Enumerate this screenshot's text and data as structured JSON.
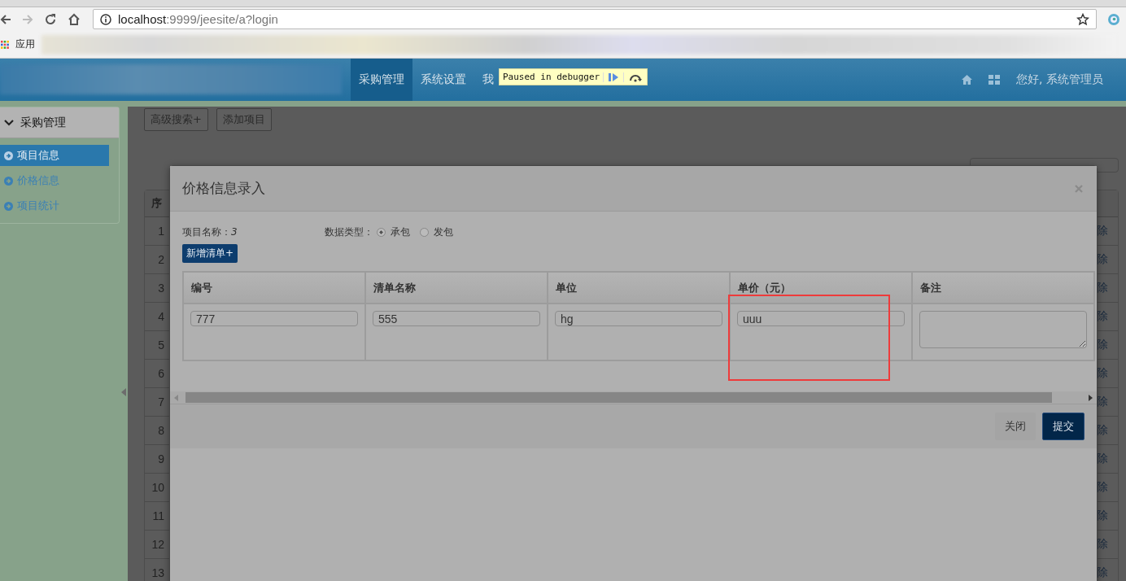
{
  "browser": {
    "url_host": "localhost",
    "url_rest": ":9999/jeesite/a?login",
    "bookmarks_label": "应用"
  },
  "debugger_banner": {
    "text": "Paused in debugger"
  },
  "navbar": {
    "items": [
      {
        "label": "采购管理",
        "selected": true
      },
      {
        "label": "系统设置",
        "selected": false
      },
      {
        "label": "我",
        "selected": false
      }
    ],
    "greeting": "您好, 系统管理员"
  },
  "sidebar": {
    "title": "采购管理",
    "expanded": true,
    "items": [
      {
        "label": "项目信息",
        "selected": true
      },
      {
        "label": "价格信息",
        "selected": false
      },
      {
        "label": "项目统计",
        "selected": false
      }
    ]
  },
  "main": {
    "buttons": [
      "高级搜索+",
      "添加项目"
    ],
    "table": {
      "header": "序",
      "row_numbers": [
        "1",
        "2",
        "3",
        "4",
        "5",
        "6",
        "7",
        "8",
        "9",
        "10",
        "11",
        "12",
        "13"
      ],
      "row_actions": [
        "除",
        "除",
        "除",
        "除",
        "除",
        "除",
        "除",
        "除",
        "除",
        "除",
        "除",
        "除",
        "除"
      ]
    }
  },
  "modal": {
    "title": "价格信息录入",
    "project_name": "项目名称：*3*",
    "data_type": {
      "label": "数据类型：",
      "options": [
        {
          "label": "承包",
          "selected": true
        },
        {
          "label": "发包",
          "selected": false
        }
      ]
    },
    "add_button": "新增清单+",
    "columns": [
      "编号",
      "清单名称",
      "单位",
      "单价（元）",
      "备注"
    ],
    "row": [
      {
        "kind": "input",
        "value": "777"
      },
      {
        "kind": "input",
        "value": "555"
      },
      {
        "kind": "input",
        "value": "hg"
      },
      {
        "kind": "input",
        "value": "uuu"
      },
      {
        "kind": "textarea"
      }
    ],
    "buttons": [
      {
        "label": "关闭",
        "kind": "default"
      },
      {
        "label": "提交",
        "kind": "primary"
      }
    ]
  }
}
